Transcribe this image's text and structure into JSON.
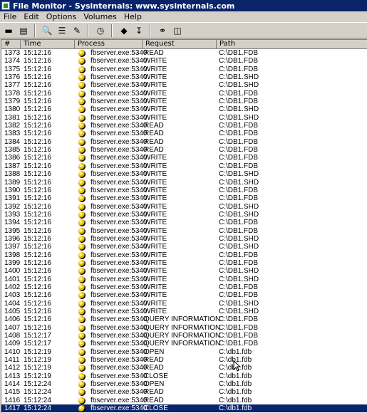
{
  "window": {
    "title": "File Monitor - Sysinternals: www.sysinternals.com"
  },
  "menu": [
    "File",
    "Edit",
    "Options",
    "Volumes",
    "Help"
  ],
  "toolbar": [
    {
      "name": "save-icon",
      "glyph": "▬"
    },
    {
      "name": "open-icon",
      "glyph": "▤"
    },
    {
      "sep": true
    },
    {
      "name": "magnify-icon",
      "glyph": "🔍"
    },
    {
      "name": "properties-icon",
      "glyph": "☰"
    },
    {
      "name": "filter-icon",
      "glyph": "✎"
    },
    {
      "sep": true
    },
    {
      "name": "clock-icon",
      "glyph": "◷"
    },
    {
      "sep": true
    },
    {
      "name": "highlight-icon",
      "glyph": "◆"
    },
    {
      "name": "pin-icon",
      "glyph": "↧"
    },
    {
      "sep": true
    },
    {
      "name": "find-icon",
      "glyph": "⚭"
    },
    {
      "name": "jump-icon",
      "glyph": "◫"
    }
  ],
  "columns": [
    "#",
    "Time",
    "Process",
    "Request",
    "Path"
  ],
  "rows": [
    [
      "1373",
      "15:12:16",
      "fbserver.exe:5340",
      "READ",
      "C:\\DB1.FDB"
    ],
    [
      "1374",
      "15:12:16",
      "fbserver.exe:5340",
      "WRITE",
      "C:\\DB1.FDB"
    ],
    [
      "1375",
      "15:12:16",
      "fbserver.exe:5340",
      "WRITE",
      "C:\\DB1.FDB"
    ],
    [
      "1376",
      "15:12:16",
      "fbserver.exe:5340",
      "WRITE",
      "C:\\DB1.SHD"
    ],
    [
      "1377",
      "15:12:16",
      "fbserver.exe:5340",
      "WRITE",
      "C:\\DB1.SHD"
    ],
    [
      "1378",
      "15:12:16",
      "fbserver.exe:5340",
      "WRITE",
      "C:\\DB1.FDB"
    ],
    [
      "1379",
      "15:12:16",
      "fbserver.exe:5340",
      "WRITE",
      "C:\\DB1.FDB"
    ],
    [
      "1380",
      "15:12:16",
      "fbserver.exe:5340",
      "WRITE",
      "C:\\DB1.SHD"
    ],
    [
      "1381",
      "15:12:16",
      "fbserver.exe:5340",
      "WRITE",
      "C:\\DB1.SHD"
    ],
    [
      "1382",
      "15:12:16",
      "fbserver.exe:5340",
      "READ",
      "C:\\DB1.FDB"
    ],
    [
      "1383",
      "15:12:16",
      "fbserver.exe:5340",
      "READ",
      "C:\\DB1.FDB"
    ],
    [
      "1384",
      "15:12:16",
      "fbserver.exe:5340",
      "READ",
      "C:\\DB1.FDB"
    ],
    [
      "1385",
      "15:12:16",
      "fbserver.exe:5340",
      "READ",
      "C:\\DB1.FDB"
    ],
    [
      "1386",
      "15:12:16",
      "fbserver.exe:5340",
      "WRITE",
      "C:\\DB1.FDB"
    ],
    [
      "1387",
      "15:12:16",
      "fbserver.exe:5340",
      "WRITE",
      "C:\\DB1.FDB"
    ],
    [
      "1388",
      "15:12:16",
      "fbserver.exe:5340",
      "WRITE",
      "C:\\DB1.SHD"
    ],
    [
      "1389",
      "15:12:16",
      "fbserver.exe:5340",
      "WRITE",
      "C:\\DB1.SHD"
    ],
    [
      "1390",
      "15:12:16",
      "fbserver.exe:5340",
      "WRITE",
      "C:\\DB1.FDB"
    ],
    [
      "1391",
      "15:12:16",
      "fbserver.exe:5340",
      "WRITE",
      "C:\\DB1.FDB"
    ],
    [
      "1392",
      "15:12:16",
      "fbserver.exe:5340",
      "WRITE",
      "C:\\DB1.SHD"
    ],
    [
      "1393",
      "15:12:16",
      "fbserver.exe:5340",
      "WRITE",
      "C:\\DB1.SHD"
    ],
    [
      "1394",
      "15:12:16",
      "fbserver.exe:5340",
      "WRITE",
      "C:\\DB1.FDB"
    ],
    [
      "1395",
      "15:12:16",
      "fbserver.exe:5340",
      "WRITE",
      "C:\\DB1.FDB"
    ],
    [
      "1396",
      "15:12:16",
      "fbserver.exe:5340",
      "WRITE",
      "C:\\DB1.SHD"
    ],
    [
      "1397",
      "15:12:16",
      "fbserver.exe:5340",
      "WRITE",
      "C:\\DB1.SHD"
    ],
    [
      "1398",
      "15:12:16",
      "fbserver.exe:5340",
      "WRITE",
      "C:\\DB1.FDB"
    ],
    [
      "1399",
      "15:12:16",
      "fbserver.exe:5340",
      "WRITE",
      "C:\\DB1.FDB"
    ],
    [
      "1400",
      "15:12:16",
      "fbserver.exe:5340",
      "WRITE",
      "C:\\DB1.SHD"
    ],
    [
      "1401",
      "15:12:16",
      "fbserver.exe:5340",
      "WRITE",
      "C:\\DB1.SHD"
    ],
    [
      "1402",
      "15:12:16",
      "fbserver.exe:5340",
      "WRITE",
      "C:\\DB1.FDB"
    ],
    [
      "1403",
      "15:12:16",
      "fbserver.exe:5340",
      "WRITE",
      "C:\\DB1.FDB"
    ],
    [
      "1404",
      "15:12:16",
      "fbserver.exe:5340",
      "WRITE",
      "C:\\DB1.SHD"
    ],
    [
      "1405",
      "15:12:16",
      "fbserver.exe:5340",
      "WRITE",
      "C:\\DB1.SHD"
    ],
    [
      "1406",
      "15:12:16",
      "fbserver.exe:5340",
      "QUERY INFORMATION",
      "C:\\DB1.FDB"
    ],
    [
      "1407",
      "15:12:16",
      "fbserver.exe:5340",
      "QUERY INFORMATION",
      "C:\\DB1.FDB"
    ],
    [
      "1408",
      "15:12:17",
      "fbserver.exe:5340",
      "QUERY INFORMATION",
      "C:\\DB1.FDB"
    ],
    [
      "1409",
      "15:12:17",
      "fbserver.exe:5340",
      "QUERY INFORMATION",
      "C:\\DB1.FDB"
    ],
    [
      "1410",
      "15:12:19",
      "fbserver.exe:5340",
      "OPEN",
      "C:\\db1.fdb"
    ],
    [
      "1411",
      "15:12:19",
      "fbserver.exe:5340",
      "READ",
      "C:\\db1.fdb"
    ],
    [
      "1412",
      "15:12:19",
      "fbserver.exe:5340",
      "READ",
      "C:\\db1.fdb"
    ],
    [
      "1413",
      "15:12:19",
      "fbserver.exe:5340",
      "CLOSE",
      "C:\\db1.fdb"
    ],
    [
      "1414",
      "15:12:24",
      "fbserver.exe:5340",
      "OPEN",
      "C:\\db1.fdb"
    ],
    [
      "1415",
      "15:12:24",
      "fbserver.exe:5340",
      "READ",
      "C:\\db1.fdb"
    ],
    [
      "1416",
      "15:12:24",
      "fbserver.exe:5340",
      "READ",
      "C:\\db1.fdb"
    ],
    [
      "1417",
      "15:12:24",
      "fbserver.exe:5340",
      "CLOSE",
      "C:\\db1.fdb"
    ]
  ],
  "selected_row": "1417"
}
